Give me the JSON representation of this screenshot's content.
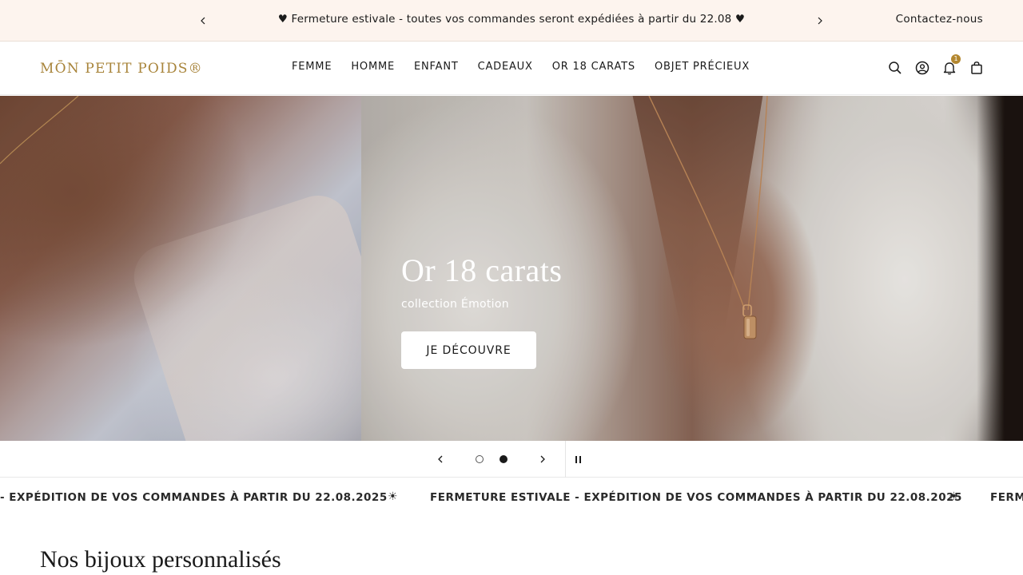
{
  "announcement": {
    "message": "♥ Fermeture estivale - toutes vos commandes seront expédiées à partir du 22.08 ♥",
    "contact_label": "Contactez-nous"
  },
  "header": {
    "logo_text": "MŌN PETIT POIDS®",
    "nav": [
      "FEMME",
      "HOMME",
      "ENFANT",
      "CADEAUX",
      "OR 18 CARATS",
      "OBJET PRÉCIEUX"
    ],
    "notification_count": "1",
    "icons": [
      "search-icon",
      "account-icon",
      "bell-icon",
      "bag-icon"
    ]
  },
  "hero": {
    "title": "Or 18 carats",
    "subtitle": "collection Émotion",
    "button_label": "JE DÉCOUVRE"
  },
  "slider": {
    "slides_total": 2,
    "active_slide": 2
  },
  "marquee": {
    "items": [
      "- EXPÉDITION DE VOS COMMANDES À PARTIR DU 22.08.2025",
      "FERMETURE ESTIVALE - EXPÉDITION DE VOS COMMANDES À PARTIR DU 22.08.2025",
      "FERM"
    ],
    "separator": "☀"
  },
  "section": {
    "title": "Nos bijoux personnalisés"
  },
  "colors": {
    "announce_bg": "#fdf4ee",
    "brand_gold": "#a8843a",
    "badge": "#b3872f"
  }
}
